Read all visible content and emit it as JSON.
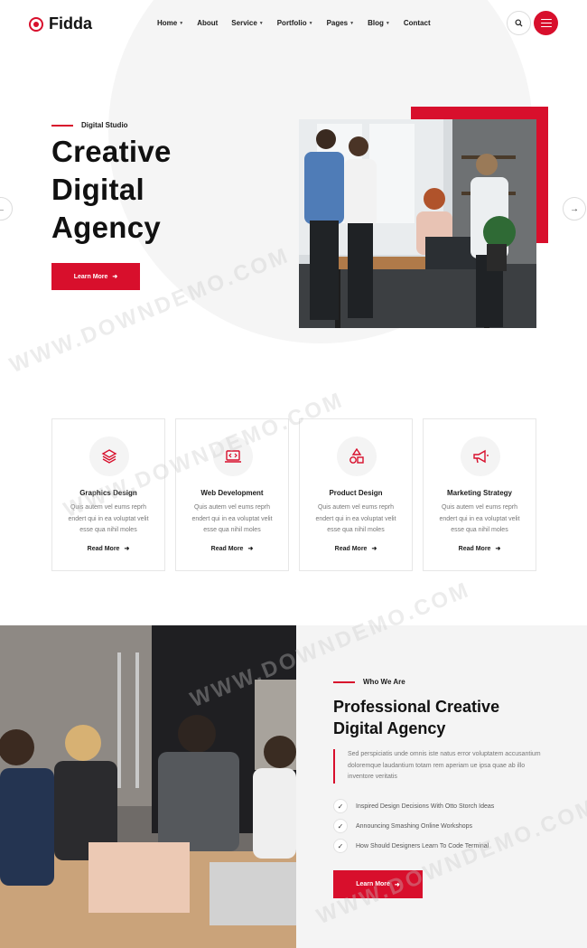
{
  "brand": {
    "name": "Fidda",
    "accent": "#d80f2c"
  },
  "nav": [
    {
      "label": "Home",
      "dropdown": true
    },
    {
      "label": "About",
      "dropdown": false
    },
    {
      "label": "Service",
      "dropdown": true
    },
    {
      "label": "Portfolio",
      "dropdown": true
    },
    {
      "label": "Pages",
      "dropdown": true
    },
    {
      "label": "Blog",
      "dropdown": true
    },
    {
      "label": "Contact",
      "dropdown": false
    }
  ],
  "header_icons": {
    "search": "search-icon",
    "menu": "hamburger-menu-icon"
  },
  "hero": {
    "eyebrow": "Digital Studio",
    "title_lines": [
      "Creative",
      "Digital",
      "Agency"
    ],
    "button": "Learn More",
    "button_icon": "arrow-right-icon",
    "slider_prev": "←",
    "slider_next": "→"
  },
  "services": [
    {
      "icon": "layers-icon",
      "title": "Graphics Design",
      "text": "Quis autem vel eums reprh endert qui in ea voluptat velit esse qua nihil moles",
      "link": "Read More"
    },
    {
      "icon": "code-laptop-icon",
      "title": "Web Development",
      "text": "Quis autem vel eums reprh endert qui in ea voluptat velit esse qua nihil moles",
      "link": "Read More"
    },
    {
      "icon": "shapes-icon",
      "title": "Product Design",
      "text": "Quis autem vel eums reprh endert qui in ea voluptat velit esse qua nihil moles",
      "link": "Read More"
    },
    {
      "icon": "megaphone-icon",
      "title": "Marketing Strategy",
      "text": "Quis autem vel eums reprh endert qui in ea voluptat velit esse qua nihil moles",
      "link": "Read More"
    }
  ],
  "about": {
    "eyebrow": "Who We Are",
    "title_lines": [
      "Professional Creative",
      "Digital Agency"
    ],
    "text": "Sed perspiciatis unde omnis iste natus error voluptatem accusantium doloremque laudantium totam rem aperiam ue ipsa quae ab illo inventore veritatis",
    "list": [
      "Inspired Design Decisions With Otto Storch Ideas",
      "Announcing Smashing Online Workshops",
      "How Should Designers Learn To Code Terminal"
    ],
    "button": "Learn More"
  },
  "watermark": "WWW.DOWNDEMO.COM"
}
